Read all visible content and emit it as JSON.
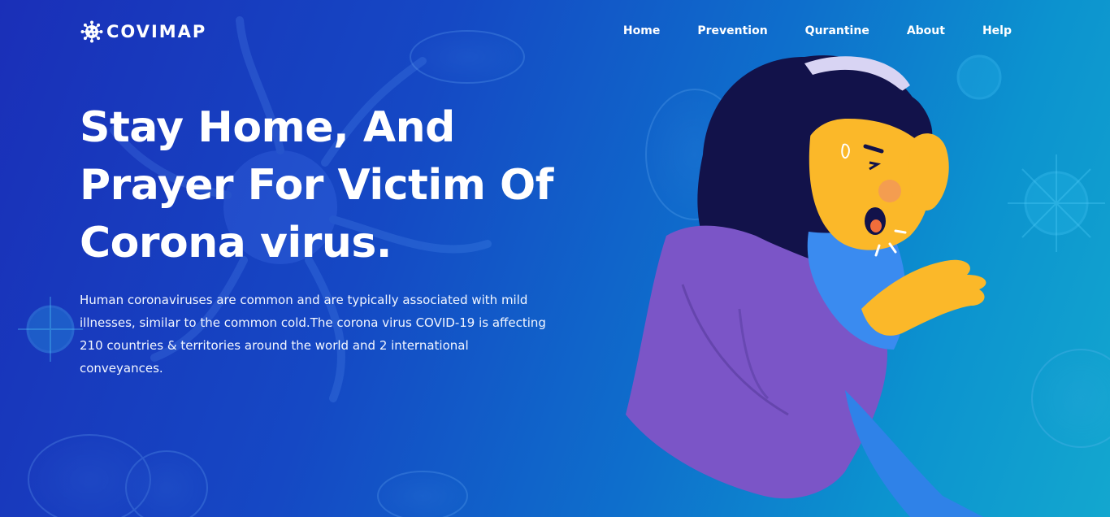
{
  "brand": {
    "name": "COVIMAP",
    "icon": "virus-icon"
  },
  "nav": {
    "items": [
      {
        "label": "Home"
      },
      {
        "label": "Prevention"
      },
      {
        "label": "Qurantine"
      },
      {
        "label": "About"
      },
      {
        "label": "Help"
      }
    ]
  },
  "hero": {
    "title": "Stay Home, And Prayer For Victim Of Corona virus.",
    "text": "Human coronaviruses are common and are typically associated with mild illnesses, similar to the common cold.The corona virus COVID-19 is affecting 210 countries & territories around the world and 2 international conveyances."
  },
  "illustration": {
    "icon": "coughing-woman-illustration"
  },
  "colors": {
    "background_start": "#1a2fb8",
    "background_end": "#13a7cf",
    "text": "#ffffff",
    "sweater": "#7b55c7",
    "skin": "#fbb829",
    "hair": "#12124a"
  }
}
